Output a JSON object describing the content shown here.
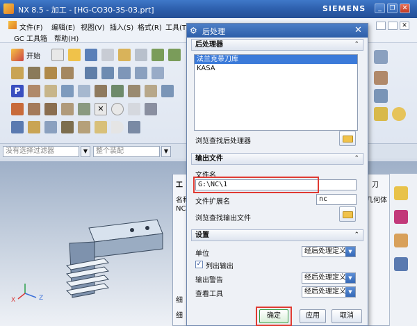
{
  "window": {
    "title": "NX 8.5 - 加工 - [HG-CO30-3S-03.prt]",
    "brand": "SIEMENS"
  },
  "menubar": {
    "items": [
      "文件(F)",
      "编辑(E)",
      "视图(V)",
      "插入(S)",
      "格式(R)",
      "工具(T"
    ],
    "items_row2": [
      "GC 工具箱",
      "帮助(H)"
    ]
  },
  "toolbar": {
    "start_label": "开始"
  },
  "filterbar": {
    "filter_placeholder": "没有选择过滤器",
    "component_placeholder": "整个装配"
  },
  "navigator": {
    "col_name": "名称",
    "row1": "NC",
    "tab_prefix": "工",
    "right_header": "刀",
    "right_col": "几何体",
    "bottom1": "细",
    "bottom2": "细"
  },
  "dialog": {
    "title": "后处理",
    "section_postprocessor": "后处理器",
    "postprocessor_list": [
      {
        "label": "法兰克带刀库",
        "selected": true
      },
      {
        "label": "KASA",
        "selected": false
      }
    ],
    "browse_postprocessor_label": "浏览查找后处理器",
    "section_output": "输出文件",
    "file_name_label": "文件名",
    "file_name_value": "G:\\NC\\1",
    "file_ext_label": "文件扩展名",
    "file_ext_value": "nc",
    "browse_output_label": "浏览查找输出文件",
    "section_settings": "设置",
    "unit_label": "单位",
    "unit_value": "经后处理定义",
    "list_output_label": "列出输出",
    "list_output_checked": true,
    "warning_label": "输出警告",
    "warning_value": "经后处理定义",
    "review_tool_label": "查看工具",
    "review_tool_value": "经后处理定义",
    "ok_label": "确定",
    "apply_label": "应用",
    "cancel_label": "取消"
  },
  "colors": {
    "title_blue": "#2d5ea8",
    "highlight_red": "#e03a32",
    "selection_blue": "#3b7ad9"
  }
}
